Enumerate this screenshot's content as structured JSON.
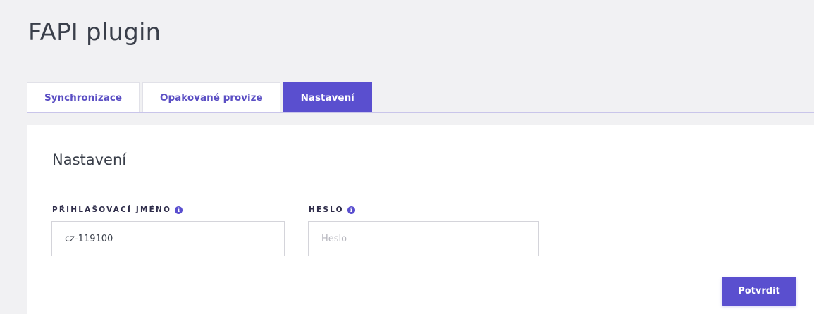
{
  "page": {
    "title": "FAPI plugin"
  },
  "tabs": [
    {
      "label": "Synchronizace",
      "active": false
    },
    {
      "label": "Opakované provize",
      "active": false
    },
    {
      "label": "Nastavení",
      "active": true
    }
  ],
  "settings": {
    "section_title": "Nastavení",
    "username": {
      "label": "PŘIHLAŠOVACÍ JMÉNO",
      "value": "cz-119100",
      "info_icon": "info-icon"
    },
    "password": {
      "label": "HESLO",
      "value": "",
      "placeholder": "Heslo",
      "info_icon": "info-icon"
    },
    "submit_label": "Potvrdit"
  },
  "colors": {
    "accent": "#5a4fcf",
    "background": "#f1f1f3",
    "card": "#ffffff",
    "heading": "#3a3f4a"
  }
}
